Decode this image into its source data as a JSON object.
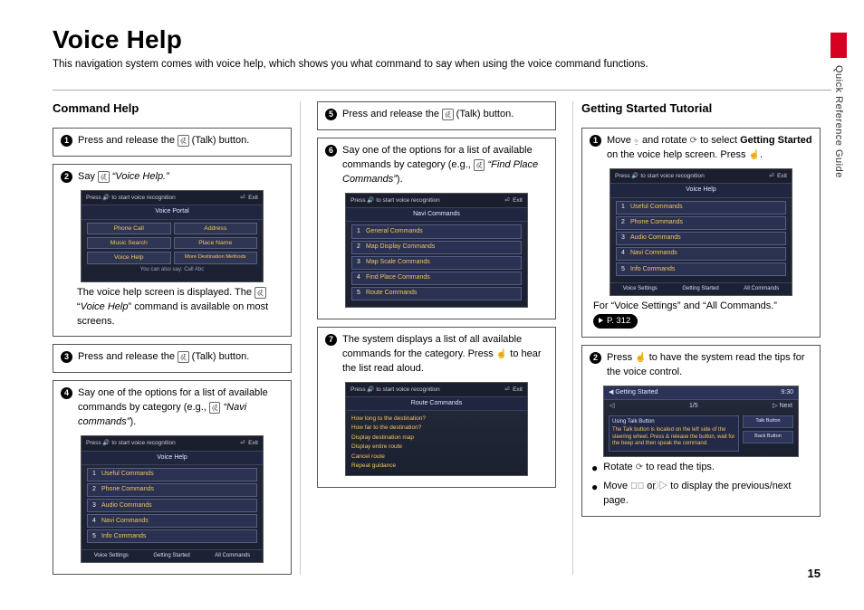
{
  "page": {
    "title": "Voice Help",
    "intro": "This navigation system comes with voice help, which shows you what command to say when using the voice command functions.",
    "side_label": "Quick Reference Guide",
    "page_number": "15"
  },
  "section_a": {
    "heading": "Command Help"
  },
  "section_b": {
    "heading": "Getting Started Tutorial"
  },
  "steps": {
    "s1": {
      "num": "1",
      "t1": "Press and release the ",
      "t_talk": " (Talk) button."
    },
    "s2": {
      "num": "2",
      "t1": "Say ",
      "voice": "“Voice Help.”",
      "cap1": "The voice help screen is displayed. The ",
      "cap2": " “",
      "cap3": "Voice Help",
      "cap4": "” command is available on most screens."
    },
    "s3": {
      "num": "3",
      "t1": "Press and release the ",
      "t_talk": " (Talk) button."
    },
    "s4": {
      "num": "4",
      "t1": "Say one of the options for a list of available commands by category (e.g., ",
      "voice": "“Navi commands”",
      "t2": ")."
    },
    "s5": {
      "num": "5",
      "t1": "Press and release the ",
      "t_talk": " (Talk) button."
    },
    "s6": {
      "num": "6",
      "t1": "Say one of the options for a list of available commands by category (e.g., ",
      "voice": "“Find Place Commands”",
      "t2": ")."
    },
    "s7": {
      "num": "7",
      "t1": "The system displays a list of all available commands for the category. Press ",
      "t2": " to hear the list read aloud."
    },
    "b1": {
      "num": "1",
      "t1": "Move ",
      "t2": " and rotate ",
      "t3": " to select ",
      "bold": "Getting Started",
      "t4": " on the voice help screen. Press ",
      "t5": ".",
      "foot_a": "For “Voice Settings” and “All Commands.” ",
      "pill": "P. 312"
    },
    "b2": {
      "num": "2",
      "t1": "Press ",
      "t2": " to have the system read the tips for the voice control.",
      "n1": "Rotate ",
      "n1b": " to read the tips.",
      "n2": "Move ",
      "n2b": " or ",
      "n2c": " to display the previous/next page."
    }
  },
  "screens": {
    "topbar_left": "Press 🔊 to start voice recognition",
    "topbar_right_back": "⏎",
    "topbar_right_exit": "Exit",
    "portal": {
      "title": "Voice Portal",
      "btns": [
        "Phone Call",
        "Address",
        "Music Search",
        "Place Name",
        "Voice Help",
        "More Destination Methods"
      ],
      "foot": "You can also say: Call Abc"
    },
    "help_list": {
      "title": "Voice Help",
      "rows": [
        "Useful Commands",
        "Phone Commands",
        "Audio Commands",
        "Navi Commands",
        "Info Commands"
      ],
      "tabs": [
        "Voice Settings",
        "Getting Started",
        "All Commands"
      ]
    },
    "navi_list": {
      "title": "Navi Commands",
      "rows": [
        "General Commands",
        "Map Display Commands",
        "Map Scale Commands",
        "Find Place Commands",
        "Route Commands"
      ]
    },
    "route": {
      "title": "Route Commands",
      "lines": [
        "How long to the destination?",
        "How far to the destination?",
        "Display destination map",
        "Display entire route",
        "Cancel route",
        "Repeat guidance"
      ]
    },
    "gs": {
      "head": "Getting Started",
      "clock": "9:30",
      "arrow_mid": "1/5",
      "arrow_next": "Next",
      "panel_title": "Using Talk Button",
      "panel_body": "The Talk button is located on the left side of the steering wheel. Press & release the button, wait for the beep and then speak the command.",
      "side": [
        "Talk Button",
        "Back Button"
      ]
    }
  }
}
